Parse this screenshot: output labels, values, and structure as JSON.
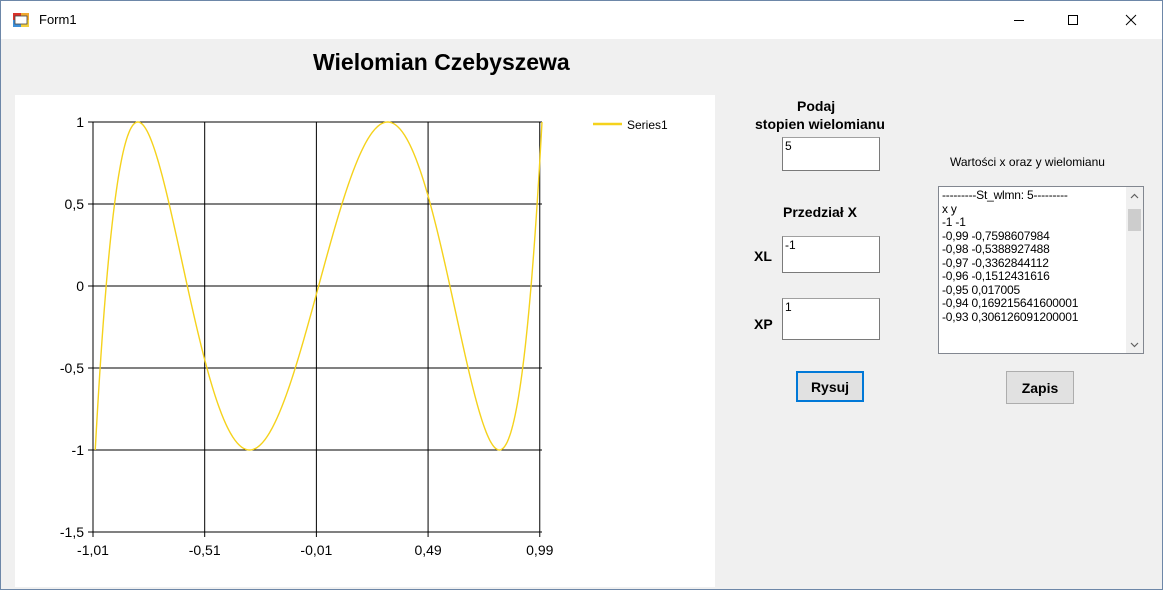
{
  "window": {
    "title": "Form1"
  },
  "form": {
    "heading": "Wielomian Czebyszewa",
    "degree_label_line1": "Podaj",
    "degree_label_line2": "stopien wielomianu",
    "degree_value": "5",
    "interval_label": "Przedział X",
    "xl_label": "XL",
    "xl_value": "-1",
    "xp_label": "XP",
    "xp_value": "1",
    "draw_button": "Rysuj",
    "save_button": "Zapis",
    "list_caption": "Wartości x oraz y wielomianu",
    "list_items": [
      "---------St_wlmn: 5---------",
      "x y",
      "-1 -1",
      "-0,99 -0,7598607984",
      "-0,98 -0,5388927488",
      "-0,97 -0,3362844112",
      "-0,96 -0,1512431616",
      "-0,95 0,017005",
      "-0,94 0,169215641600001",
      "-0,93 0,306126091200001"
    ]
  },
  "chart_data": {
    "type": "line",
    "function": "Chebyshev polynomial T5(x) = 16x^5 - 20x^3 + 5x",
    "degree": 5,
    "x_range": [
      -1,
      1
    ],
    "xlim": [
      -1.01,
      1.0
    ],
    "ylim": [
      -1.5,
      1
    ],
    "x_tick_labels": [
      "-1,01",
      "-0,51",
      "-0,01",
      "0,49",
      "0,99"
    ],
    "x_ticks": [
      -1.01,
      -0.51,
      -0.01,
      0.49,
      0.99
    ],
    "y_tick_labels": [
      "1",
      "0,5",
      "0",
      "-0,5",
      "-1",
      "-1,5"
    ],
    "y_ticks": [
      1,
      0.5,
      0,
      -0.5,
      -1,
      -1.5
    ],
    "grid": true,
    "legend_position": "top-right",
    "series": [
      {
        "name": "Series1",
        "color": "#f5d21c"
      }
    ]
  }
}
